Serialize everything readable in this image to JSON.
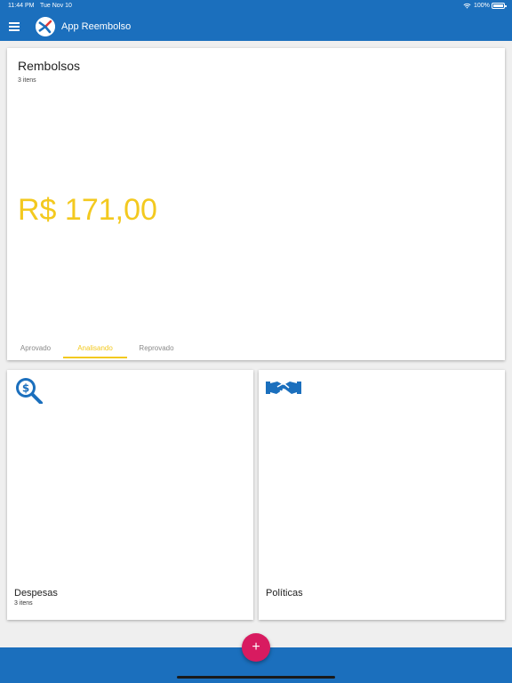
{
  "status_bar": {
    "time": "11:44 PM",
    "date": "Tue Nov 10",
    "battery": "100%"
  },
  "header": {
    "title": "App Reembolso",
    "menu_icon": "menu-icon",
    "logo_icon": "app-logo-icon"
  },
  "reimbursements": {
    "title": "Rembolsos",
    "count": "3 itens",
    "amount": "R$ 171,00",
    "tabs": [
      {
        "label": "Aprovado",
        "active": false
      },
      {
        "label": "Analisando",
        "active": true
      },
      {
        "label": "Reprovado",
        "active": false
      }
    ]
  },
  "cards": [
    {
      "icon": "money-search-icon",
      "label": "Despesas",
      "sub": "3 itens"
    },
    {
      "icon": "handshake-icon",
      "label": "Políticas",
      "sub": ""
    }
  ],
  "fab": {
    "label": "+"
  },
  "colors": {
    "primary": "#1b6fbd",
    "accent": "#f3c91f",
    "fab": "#d81b60"
  }
}
